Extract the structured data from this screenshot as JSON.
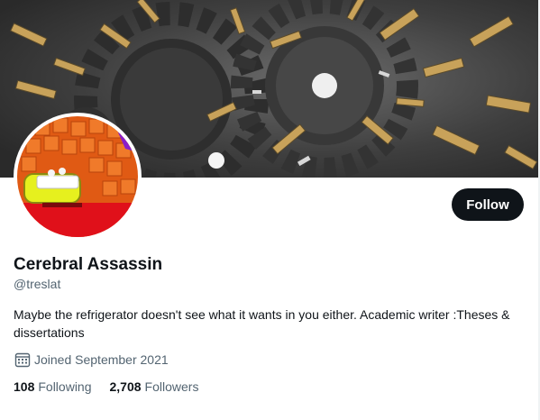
{
  "profile": {
    "display_name": "Cerebral Assassin",
    "handle": "@treslat",
    "bio": "Maybe the refrigerator doesn't see what it wants in you either. Academic writer :Theses & dissertations",
    "joined": "Joined September 2021"
  },
  "actions": {
    "follow_label": "Follow"
  },
  "stats": {
    "following_count": "108",
    "following_label": "Following",
    "followers_count": "2,708",
    "followers_label": "Followers"
  },
  "icons": {
    "joined": "calendar-icon"
  },
  "colors": {
    "primary_text": "#0f1419",
    "secondary_text": "#536471",
    "button_bg": "#0f1419",
    "button_text": "#ffffff"
  }
}
